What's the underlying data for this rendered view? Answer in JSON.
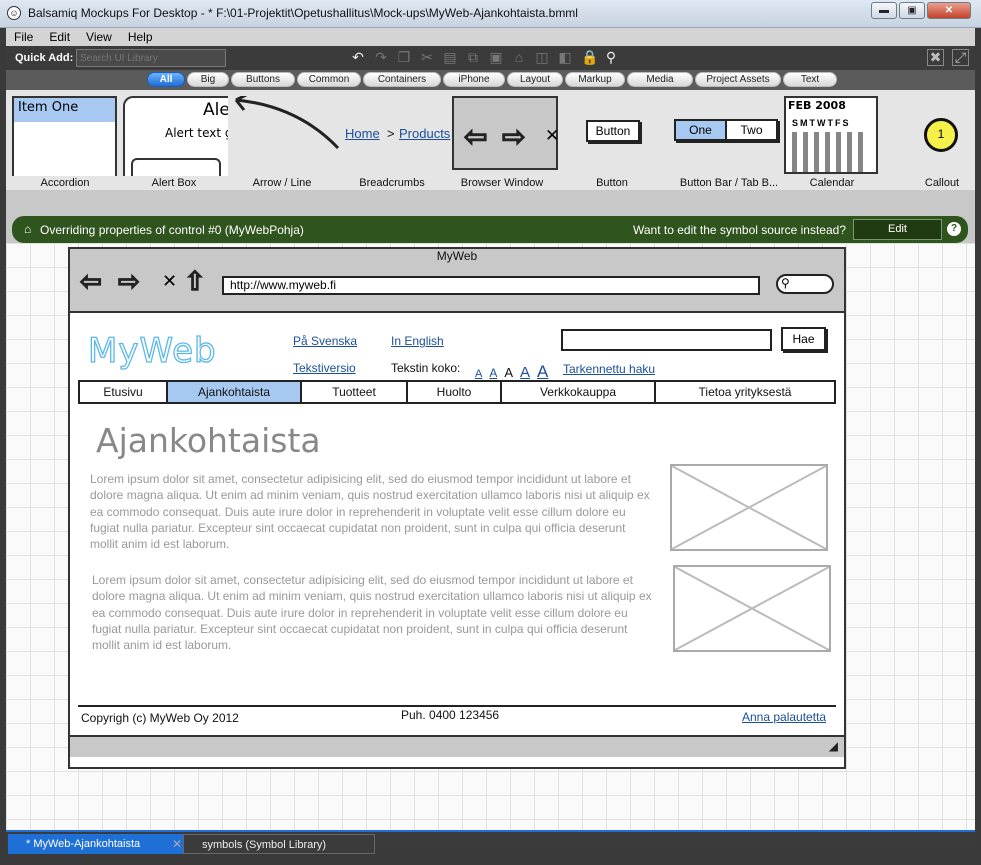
{
  "window": {
    "title": "Balsamiq Mockups For Desktop - * F:\\01-Projektit\\Opetushallitus\\Mock-ups\\MyWeb-Ajankohtaista.bmml",
    "minimize": "▬",
    "maximize": "▣",
    "close": "✕"
  },
  "menu": [
    "File",
    "Edit",
    "View",
    "Help"
  ],
  "toolbar": {
    "quick_add_label": "Quick Add:",
    "search_placeholder": "Search UI Library"
  },
  "categories": [
    "All",
    "Big",
    "Buttons",
    "Common",
    "Containers",
    "iPhone",
    "Layout",
    "Markup",
    "Media",
    "Project Assets",
    "Text"
  ],
  "active_category": "All",
  "library": {
    "accordion": {
      "label": "Accordion",
      "item": "Item One"
    },
    "alert": {
      "label": "Alert Box",
      "title": "Ale",
      "text": "Alert text g"
    },
    "arrow": {
      "label": "Arrow / Line"
    },
    "breadcrumbs": {
      "label": "Breadcrumbs",
      "home": "Home",
      "sep": ">",
      "products": "Products"
    },
    "browser": {
      "label": "Browser Window"
    },
    "button": {
      "label": "Button",
      "text": "Button"
    },
    "buttonbar": {
      "label": "Button Bar / Tab B...",
      "one": "One",
      "two": "Two"
    },
    "calendar": {
      "label": "Calendar",
      "month": "FEB 2008",
      "days": "SMTWTFS"
    },
    "callout": {
      "label": "Callout",
      "number": "1"
    }
  },
  "override_bar": {
    "title": "Overriding properties of control #0 (MyWebPohja)",
    "question": "Want to edit the symbol source instead?",
    "edit": "Edit",
    "help": "?"
  },
  "mockup": {
    "browser_title": "MyWeb",
    "url": "http://www.myweb.fi",
    "logo": "MyWeb",
    "lang_sv": "På Svenska",
    "lang_en": "In English",
    "text_version": "Tekstiversio",
    "text_size_label": "Tekstin koko:",
    "size_letters": [
      "A",
      "A",
      "A",
      "A",
      "A"
    ],
    "advanced_search": "Tarkennettu haku",
    "search_button": "Hae",
    "nav": [
      "Etusivu",
      "Ajankohtaista",
      "Tuotteet",
      "Huolto",
      "Verkkokauppa",
      "Tietoa yrityksestä"
    ],
    "selected_nav": "Ajankohtaista",
    "heading": "Ajankohtaista",
    "para1": "Lorem ipsum dolor sit amet, consectetur adipisicing elit, sed do eiusmod tempor incididunt ut labore et dolore magna aliqua. Ut enim ad minim veniam, quis nostrud exercitation ullamco laboris nisi ut aliquip ex ea commodo consequat. Duis aute irure dolor in reprehenderit in voluptate velit esse cillum dolore eu fugiat nulla pariatur. Excepteur sint occaecat cupidatat non proident, sunt in culpa qui officia deserunt mollit anim id est laborum.",
    "para2": "Lorem ipsum dolor sit amet, consectetur adipisicing elit, sed do eiusmod tempor incididunt ut labore et dolore magna aliqua. Ut enim ad minim veniam, quis nostrud exercitation ullamco laboris nisi ut aliquip ex ea commodo consequat. Duis aute irure dolor in reprehenderit in voluptate velit esse cillum dolore eu fugiat nulla pariatur. Excepteur sint occaecat cupidatat non proident, sunt in culpa qui officia deserunt mollit anim id est laborum.",
    "copyright": "Copyrigh (c) MyWeb Oy  2012",
    "phone": "Puh. 0400 123456",
    "feedback": "Anna palautetta"
  },
  "doc_tabs": {
    "active": "* MyWeb-Ajankohtaista",
    "other": "symbols (Symbol Library)",
    "close": "✕"
  }
}
